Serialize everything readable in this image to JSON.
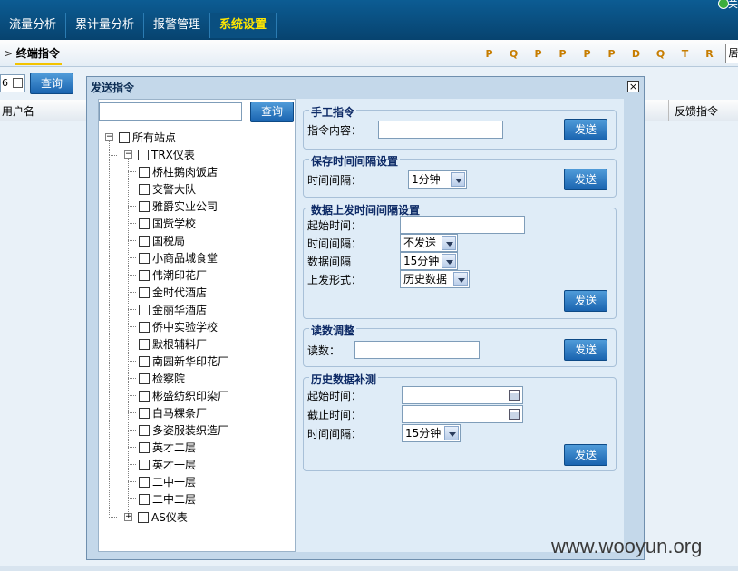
{
  "nav": {
    "items": [
      "流量分析",
      "累计量分析",
      "报警管理",
      "系统设置"
    ],
    "active": 3,
    "top_right": "关"
  },
  "subbar": {
    "crumb_prefix": ">",
    "crumb": "终端指令",
    "icon_glyphs": [
      "P",
      "Q",
      "P",
      "P",
      "P",
      "P",
      "D",
      "Q",
      "T",
      "R"
    ],
    "end_button": "居"
  },
  "page": {
    "page_input": "6",
    "query_button": "查询",
    "columns": [
      "用户名",
      "反馈指令"
    ]
  },
  "dialog": {
    "title": "发送指令",
    "close": "×",
    "search": {
      "placeholder": "",
      "button": "查询"
    },
    "tree": {
      "root": "所有站点",
      "group1": "TRX仪表",
      "sites": [
        "桥柱鹅肉饭店",
        "交警大队",
        "雅爵实业公司",
        "国赀学校",
        "国税局",
        "小商品城食堂",
        "伟潮印花厂",
        "金时代酒店",
        "金丽华酒店",
        "侨中实验学校",
        "默根辅料厂",
        "南园新华印花厂",
        "检察院",
        "彬盛纺织印染厂",
        "白马粿条厂",
        "多姿服装织造厂",
        "英才二层",
        "英才一层",
        "二中一层",
        "二中二层"
      ],
      "group2": "AS仪表"
    },
    "manual": {
      "legend": "手工指令",
      "label": "指令内容：",
      "value": "",
      "send": "发送"
    },
    "save_interval": {
      "legend": "保存时间间隔设置",
      "label": "时间间隔：",
      "selected": "1分钟",
      "send": "发送"
    },
    "upload": {
      "legend": "数据上发时间间隔设置",
      "start_label": "起始时间：",
      "start_value": "",
      "interval_label": "时间间隔：",
      "interval_selected": "不发送",
      "data_label": "数据间隔",
      "data_selected": "15分钟",
      "form_label": "上发形式：",
      "form_selected": "历史数据",
      "send": "发送"
    },
    "reading": {
      "legend": "读数调整",
      "label": "读数：",
      "value": "",
      "send": "发送"
    },
    "history": {
      "legend": "历史数据补测",
      "start_label": "起始时间：",
      "start_value": "",
      "end_label": "截止时间：",
      "end_value": "",
      "interval_label": "时间间隔：",
      "interval_selected": "15分钟",
      "send": "发送"
    }
  },
  "watermark": "www.wooyun.org"
}
